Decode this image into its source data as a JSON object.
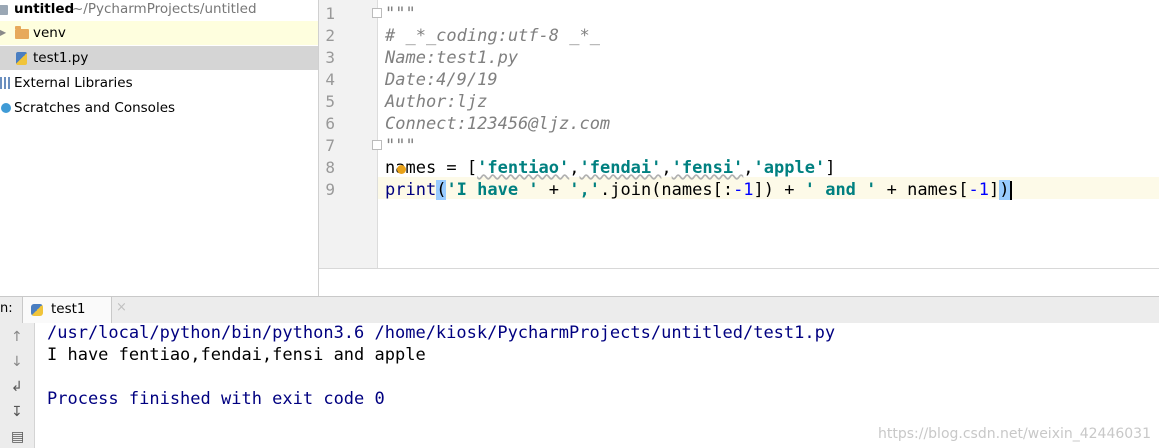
{
  "project_tree": {
    "root_label": "untitled",
    "root_path": "~/PycharmProjects/untitled",
    "items": [
      {
        "label": "venv",
        "icon": "folder-icon"
      },
      {
        "label": "test1.py",
        "icon": "python-file-icon"
      },
      {
        "label": "External Libraries",
        "icon": "library-icon"
      },
      {
        "label": "Scratches and Consoles",
        "icon": "scratches-icon"
      }
    ]
  },
  "editor": {
    "line_numbers": [
      "1",
      "2",
      "3",
      "4",
      "5",
      "6",
      "7",
      "8",
      "9"
    ],
    "lines": {
      "l1": "\"\"\"",
      "l2": "# _*_coding:utf-8 _*_",
      "l3": "Name:test1.py",
      "l4": "Date:4/9/19",
      "l5": "Author:ljz",
      "l6": "Connect:123456@ljz.com",
      "l7": "\"\"\""
    },
    "line8": {
      "a": "names = [",
      "s1": "'fentiao'",
      "c1": ",",
      "s2": "'fendai'",
      "c2": ",",
      "s3": "'fensi'",
      "c3": ",",
      "s4": "'apple'",
      "b": "]"
    },
    "line9": {
      "fn": "print",
      "lp": "(",
      "s1": "'I have '",
      "p1": " + ",
      "s2": "','",
      "j": ".join(names[:",
      "n1": "-1",
      "k": "]) + ",
      "s3": "' and '",
      "p2": " + names[",
      "n2": "-1",
      "e": "]",
      "rp": ")"
    }
  },
  "run_panel": {
    "label": "n:",
    "tab_label": "test1",
    "close_glyph": "×",
    "console": {
      "command": "/usr/local/python/bin/python3.6 /home/kiosk/PycharmProjects/untitled/test1.py",
      "output": "I have fentiao,fendai,fensi and apple",
      "exit": "Process finished with exit code 0"
    }
  },
  "watermark": "https://blog.csdn.net/weixin_42446031",
  "colors": {
    "keyword_string": "#008080",
    "number": "#0000ff",
    "comment": "#808080",
    "console_command": "#000080",
    "current_line": "#fdfae8"
  }
}
